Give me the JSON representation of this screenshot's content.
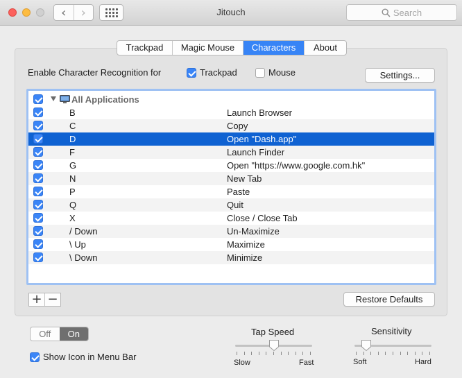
{
  "window": {
    "title": "Jitouch",
    "search_placeholder": "Search",
    "back_icon": "chevron-left-icon",
    "forward_icon": "chevron-right-icon",
    "grid_icon": "show-all-grid-icon"
  },
  "tabs": [
    {
      "label": "Trackpad",
      "active": false
    },
    {
      "label": "Magic Mouse",
      "active": false
    },
    {
      "label": "Characters",
      "active": true
    },
    {
      "label": "About",
      "active": false
    }
  ],
  "enable": {
    "label": "Enable Character Recognition for",
    "trackpad": {
      "label": "Trackpad",
      "checked": true
    },
    "mouse": {
      "label": "Mouse",
      "checked": false
    },
    "settings_button": "Settings..."
  },
  "list": {
    "group": {
      "label": "All Applications",
      "checked": true,
      "expanded": true
    },
    "rows": [
      {
        "key": "B",
        "action": "Launch Browser",
        "checked": true
      },
      {
        "key": "C",
        "action": "Copy",
        "checked": true
      },
      {
        "key": "D",
        "action": "Open \"Dash.app\"",
        "checked": true,
        "selected": true
      },
      {
        "key": "F",
        "action": "Launch Finder",
        "checked": true
      },
      {
        "key": "G",
        "action": "Open \"https://www.google.com.hk\"",
        "checked": true
      },
      {
        "key": "N",
        "action": "New Tab",
        "checked": true
      },
      {
        "key": "P",
        "action": "Paste",
        "checked": true
      },
      {
        "key": "Q",
        "action": "Quit",
        "checked": true
      },
      {
        "key": "X",
        "action": "Close / Close Tab",
        "checked": true
      },
      {
        "key": "/ Down",
        "action": "Un-Maximize",
        "checked": true
      },
      {
        "key": "\\ Up",
        "action": "Maximize",
        "checked": true
      },
      {
        "key": "\\ Down",
        "action": "Minimize",
        "checked": true
      }
    ]
  },
  "controls": {
    "add": "+",
    "remove": "−",
    "restore_defaults": "Restore Defaults"
  },
  "power": {
    "off": "Off",
    "on": "On",
    "value": "On"
  },
  "show_icon": {
    "label": "Show Icon in Menu Bar",
    "checked": true
  },
  "tap_speed": {
    "title": "Tap Speed",
    "min_label": "Slow",
    "max_label": "Fast",
    "value": 0.5
  },
  "sensitivity": {
    "title": "Sensitivity",
    "min_label": "Soft",
    "max_label": "Hard",
    "value": 0.15
  },
  "colors": {
    "accent": "#3784f6",
    "selection": "#0f62d2"
  }
}
